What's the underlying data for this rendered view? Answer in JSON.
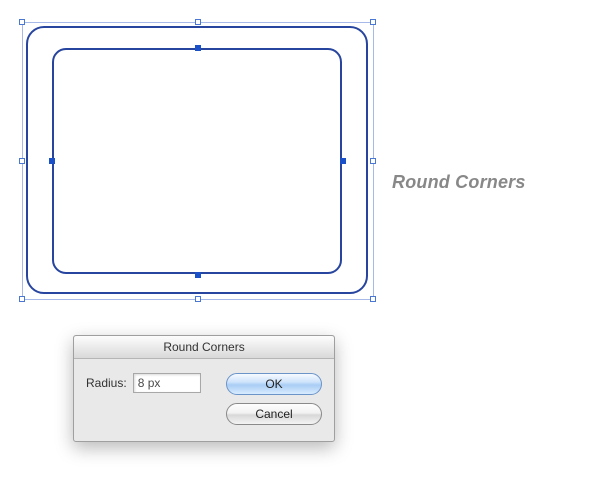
{
  "side_label": "Round Corners",
  "dialog": {
    "title": "Round Corners",
    "radius_label": "Radius:",
    "radius_value": "8 px",
    "ok_label": "OK",
    "cancel_label": "Cancel"
  },
  "colors": {
    "path_stroke": "#27459f",
    "handle_border": "#4a77d4"
  }
}
